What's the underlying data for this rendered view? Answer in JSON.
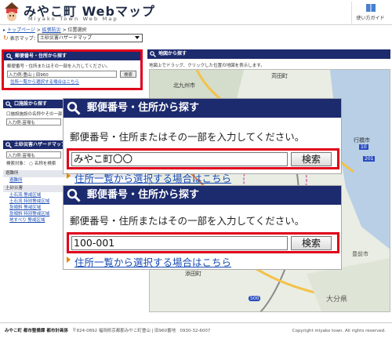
{
  "header": {
    "title": "みやこ町 Webマップ",
    "subtitle": "Miyako Town Web Map",
    "guide_label": "使い方ガイド"
  },
  "breadcrumb": {
    "items": [
      "トップページ",
      "拡張防災",
      "位置選択"
    ]
  },
  "map_select": {
    "label": "表示マップ：",
    "selected": "土砂災害ハザードマップ"
  },
  "panel_address": {
    "title": "郵便番号・住所から探す",
    "desc": "郵便番号・住所またはその一部を入力してください。",
    "input_value": "入力例:豊山 | 田960",
    "button": "検索",
    "link": "住所一覧から選択する場合はこちら"
  },
  "panel_facility": {
    "title": "口施設から探す",
    "desc": "口施設施設の名称やその一部を入力してください。",
    "input_value": "入力例:苗場も"
  },
  "panel_hazard": {
    "title": "土砂災害ハザードマップ",
    "input_value": "入力例:苗場も",
    "search_target": "検索対象：",
    "radio_label": "名称を検索",
    "sections": [
      {
        "name": "避難所",
        "items": [
          "避難所"
        ]
      },
      {
        "name": "土砂災害",
        "items": [
          "土石流 警戒区域",
          "土石流 特別警戒区域",
          "急傾斜 警戒区域",
          "急傾斜 特別警戒区域",
          "地すべり 警戒区域"
        ]
      }
    ]
  },
  "map": {
    "title": "地図から探す",
    "hint": "地図上でドラッグ、クリックした位置の地図を表示します。",
    "labels": [
      "北九州市",
      "苅田町",
      "行橋市",
      "豊前市",
      "大分県",
      "添田町"
    ],
    "route_numbers": [
      "10",
      "201",
      "500"
    ]
  },
  "zoom1": {
    "title": "郵便番号・住所から探す",
    "desc": "郵便番号・住所またはその一部を入力してください。",
    "input_value": "みやこ町〇〇",
    "button": "検索",
    "link": "住所一覧から選択する場合はこちら"
  },
  "zoom2": {
    "title": "郵便番号・住所から探す",
    "desc": "郵便番号・住所またはその一部を入力してください。",
    "input_value": "100-001",
    "button": "検索",
    "link": "住所一覧から選択する場合はこちら"
  },
  "footer": {
    "org": "みやこ町 都市整備課 都市計画係",
    "address": "〒824-0892 福岡県京都郡みやこ町豊山 | 田960番地",
    "phone": "0930-32-6007",
    "copyright": "Copyright miyako town. All rights reserved."
  },
  "colors": {
    "panel_header": "#1c2a6e",
    "highlight": "#e0001a",
    "link": "#1a4db5"
  }
}
